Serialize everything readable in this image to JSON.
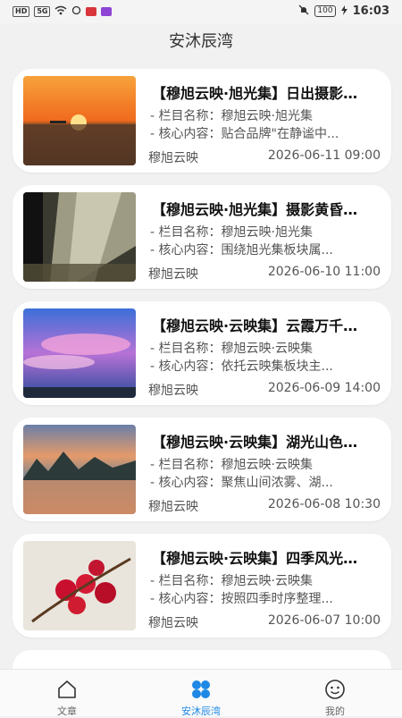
{
  "status_bar": {
    "left_icons": [
      "HD",
      "5G"
    ],
    "battery": "100",
    "time": "16:03"
  },
  "app": {
    "title": "安沐辰湾"
  },
  "articles": [
    {
      "title": "【穆旭云映·旭光集】日出摄影…",
      "column_line": "- 栏目名称：穆旭云映·旭光集",
      "content_line": "- 核心内容：贴合品牌\"在静谧中...",
      "author": "穆旭云映",
      "date": "2026-06-11 09:00",
      "image": "sunrise-sea"
    },
    {
      "title": "【穆旭云映·旭光集】摄影黄昏…",
      "column_line": "- 栏目名称：穆旭云映·旭光集",
      "content_line": "- 核心内容：围绕旭光集板块属...",
      "author": "穆旭云映",
      "date": "2026-06-10 11:00",
      "image": "forest-light-rays"
    },
    {
      "title": "【穆旭云映·云映集】云霞万千…",
      "column_line": "- 栏目名称：穆旭云映·云映集",
      "content_line": "- 核心内容：依托云映集板块主...",
      "author": "穆旭云映",
      "date": "2026-06-09 14:00",
      "image": "pink-clouds-sky"
    },
    {
      "title": "【穆旭云映·云映集】湖光山色…",
      "column_line": "- 栏目名称：穆旭云映·云映集",
      "content_line": "- 核心内容：聚焦山间浓雾、湖...",
      "author": "穆旭云映",
      "date": "2026-06-08 10:30",
      "image": "lake-mountains"
    },
    {
      "title": "【穆旭云映·云映集】四季风光…",
      "column_line": "- 栏目名称：穆旭云映·云映集",
      "content_line": "- 核心内容：按照四季时序整理...",
      "author": "穆旭云映",
      "date": "2026-06-07 10:00",
      "image": "red-berries"
    }
  ],
  "bottom_nav": [
    {
      "label": "文章",
      "icon": "home-icon"
    },
    {
      "label": "安沐辰湾",
      "icon": "clover-icon"
    },
    {
      "label": "我的",
      "icon": "smiley-icon"
    }
  ],
  "colors": {
    "accent": "#1e88e5",
    "background": "#f1f1f1",
    "card": "#ffffff"
  }
}
